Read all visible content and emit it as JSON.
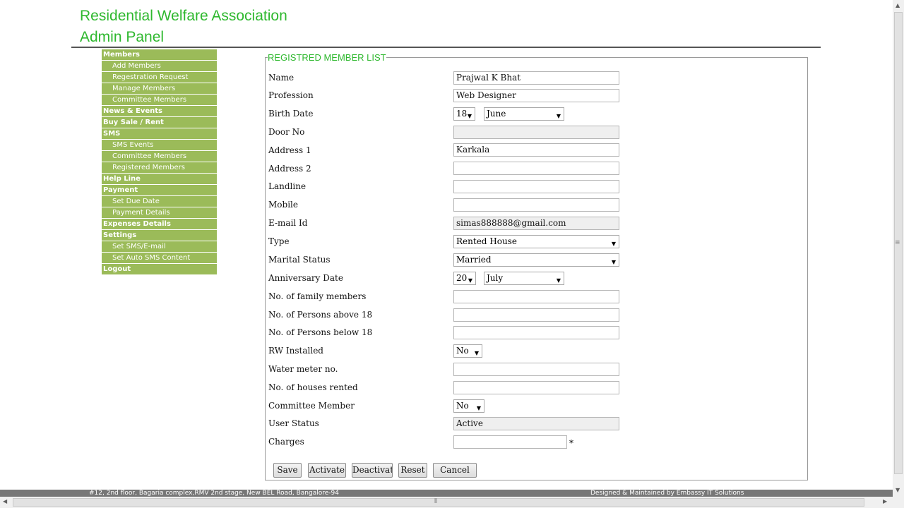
{
  "header": {
    "title_line1": "Residential Welfare Association",
    "title_line2": "Admin Panel"
  },
  "sidebar": {
    "items": [
      {
        "label": "Members",
        "type": "cat"
      },
      {
        "label": "Add Members",
        "type": "sub"
      },
      {
        "label": "Regestration Request",
        "type": "sub"
      },
      {
        "label": "Manage Members",
        "type": "sub"
      },
      {
        "label": "Committee Members",
        "type": "sub"
      },
      {
        "label": "News & Events",
        "type": "cat"
      },
      {
        "label": "Buy Sale / Rent",
        "type": "cat"
      },
      {
        "label": "SMS",
        "type": "cat"
      },
      {
        "label": "SMS Events",
        "type": "sub"
      },
      {
        "label": "Committee Members",
        "type": "sub"
      },
      {
        "label": "Registered Members",
        "type": "sub"
      },
      {
        "label": "Help Line",
        "type": "cat"
      },
      {
        "label": "Payment",
        "type": "cat"
      },
      {
        "label": "Set Due Date",
        "type": "sub"
      },
      {
        "label": "Payment Details",
        "type": "sub"
      },
      {
        "label": "Expenses Details",
        "type": "cat"
      },
      {
        "label": "Settings",
        "type": "cat"
      },
      {
        "label": "Set SMS/E-mail",
        "type": "sub"
      },
      {
        "label": "Set Auto SMS Content",
        "type": "sub"
      },
      {
        "label": "Logout",
        "type": "cat"
      }
    ]
  },
  "form": {
    "legend": "REGISTRED MEMBER LIST",
    "labels": {
      "name": "Name",
      "profession": "Profession",
      "birth_date": "Birth Date",
      "door_no": "Door No",
      "address1": "Address 1",
      "address2": "Address 2",
      "landline": "Landline",
      "mobile": "Mobile",
      "email": "E-mail Id",
      "type": "Type",
      "marital_status": "Marital Status",
      "anniversary_date": "Anniversary Date",
      "family_members": "No. of family members",
      "persons_above_18": "No. of Persons above 18",
      "persons_below_18": "No. of Persons below 18",
      "rw_installed": "RW Installed",
      "water_meter": "Water meter no.",
      "houses_rented": "No. of houses rented",
      "committee_member": "Committee Member",
      "user_status": "User Status",
      "charges": "Charges"
    },
    "values": {
      "name": "Prajwal K Bhat",
      "profession": "Web Designer",
      "birth_day": "18",
      "birth_month": "June",
      "door_no": "",
      "address1": "Karkala",
      "address2": "",
      "landline": "",
      "mobile": "",
      "email": "simas888888@gmail.com",
      "type": "Rented House",
      "marital_status": "Married",
      "anniversary_day": "20",
      "anniversary_month": "July",
      "family_members": "",
      "persons_above_18": "",
      "persons_below_18": "",
      "rw_installed": "No",
      "water_meter": "",
      "houses_rented": "",
      "committee_member": "No",
      "user_status": "Active",
      "charges": ""
    },
    "required_mark": "*"
  },
  "buttons": {
    "save": "Save",
    "activate": "Activate",
    "deactivate": "Deactivat",
    "reset": "Reset",
    "cancel": "Cancel"
  },
  "footer": {
    "address": "#12, 2nd floor, Bagaria complex,RMV 2nd stage, New BEL Road, Bangalore-94",
    "credit": "Designed & Maintained by Embassy IT Solutions"
  },
  "colors": {
    "accent_green": "#2eb82e",
    "sidebar_bg": "#9bbb59",
    "footer_bg": "#777777"
  }
}
